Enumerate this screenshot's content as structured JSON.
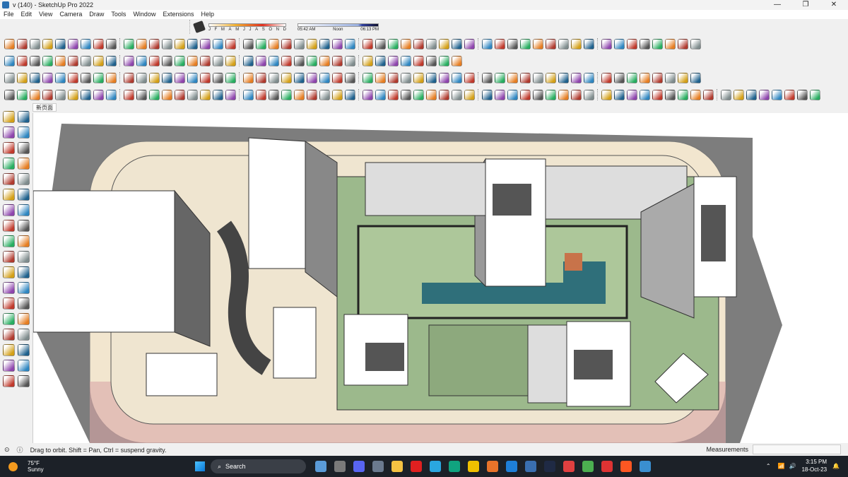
{
  "window": {
    "title": "v (140) - SketchUp Pro 2022",
    "controls": [
      "—",
      "❐",
      "✕"
    ]
  },
  "menu": [
    "File",
    "Edit",
    "View",
    "Camera",
    "Draw",
    "Tools",
    "Window",
    "Extensions",
    "Help"
  ],
  "shadows": {
    "months": [
      "J",
      "F",
      "M",
      "A",
      "M",
      "J",
      "J",
      "A",
      "S",
      "O",
      "N",
      "D"
    ],
    "time_start": "05:42 AM",
    "time_mid": "Noon",
    "time_end": "06:13 PM",
    "month_value": "S",
    "time_value_fraction": 0.8
  },
  "tab": {
    "label": "新页面"
  },
  "status": {
    "message": "Drag to orbit. Shift = Pan, Ctrl = suspend gravity.",
    "measurements_label": "Measurements",
    "measurements_value": ""
  },
  "taskbar": {
    "temperature": "75°F",
    "condition": "Sunny",
    "search_placeholder": "Search",
    "time": "3:15 PM",
    "date": "18-Oct-23"
  },
  "toolbars": {
    "row1_count": 53,
    "row2_count": 35,
    "row3_count": 53,
    "row4_count": 62,
    "palette": [
      "#c0392b",
      "#e67e22",
      "#d4a017",
      "#2e86c1",
      "#27ae60",
      "#7f8c8d",
      "#8e44ad",
      "#555555",
      "#b03a2e",
      "#1f618d"
    ]
  },
  "left_toolbar": [
    "select",
    "orbit",
    "paint-bucket",
    "eraser",
    "move-tool",
    "tape",
    "line",
    "freehand",
    "rectangle",
    "rotated-rectangle",
    "circle",
    "polygon",
    "arc",
    "pie",
    "offset",
    "follow-me",
    "move",
    "rotate",
    "scale",
    "push-pull",
    "tape-measure",
    "text",
    "protractor",
    "axes",
    "orbit-active",
    "pan",
    "zoom",
    "zoom-window",
    "zoom-extents",
    "previous",
    "walk",
    "look-around",
    "footprints",
    "position-camera",
    "section-plane",
    "section-display"
  ]
}
